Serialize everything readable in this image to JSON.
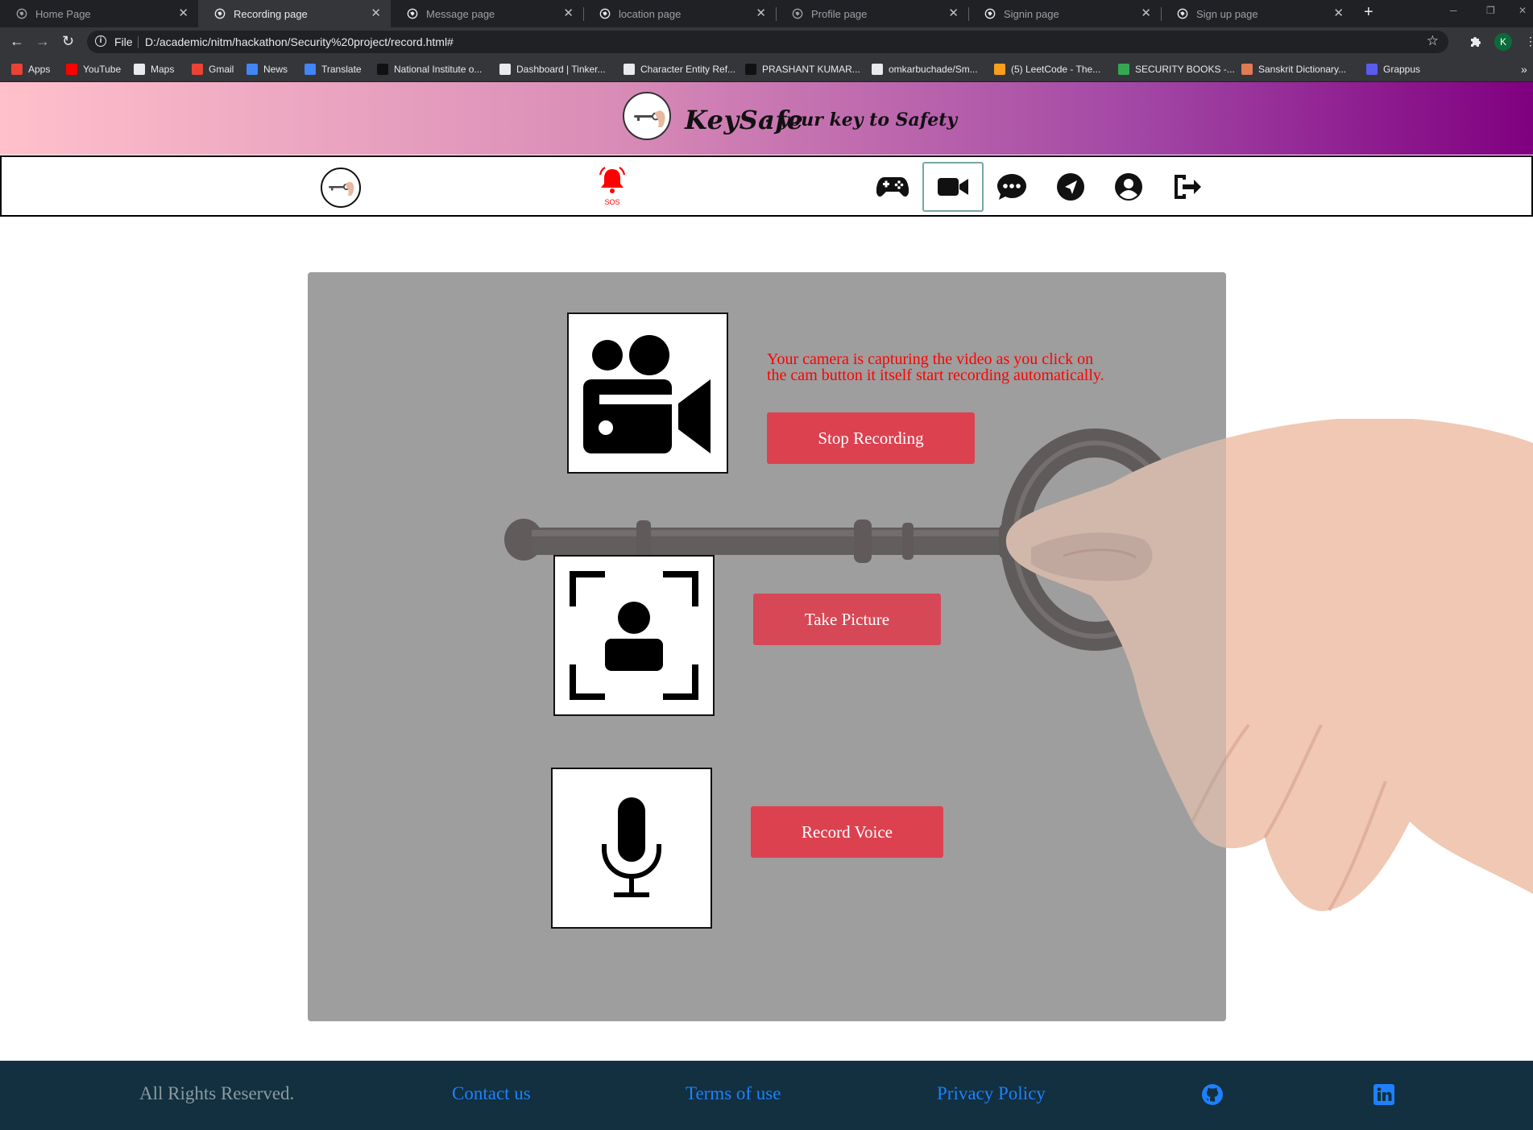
{
  "browser": {
    "tabs": [
      {
        "label": "Home Page",
        "active": false
      },
      {
        "label": "Recording page",
        "active": true
      },
      {
        "label": "Message page",
        "active": false
      },
      {
        "label": "location page",
        "active": false
      },
      {
        "label": "Profile page",
        "active": false
      },
      {
        "label": "Signin page",
        "active": false
      },
      {
        "label": "Sign up page",
        "active": false
      }
    ],
    "url_scheme_label": "File",
    "url": "D:/academic/nitm/hackathon/Security%20project/record.html#",
    "profile_initial": "K",
    "bookmarks": [
      {
        "label": "Apps",
        "icon": "apps-grid-icon",
        "color": "#ea4335"
      },
      {
        "label": "YouTube",
        "icon": "youtube-icon",
        "color": "#ff0000"
      },
      {
        "label": "Maps",
        "icon": "globe-icon",
        "color": "#e8eaed"
      },
      {
        "label": "Gmail",
        "icon": "gmail-icon",
        "color": "#ea4335"
      },
      {
        "label": "News",
        "icon": "news-icon",
        "color": "#4285f4"
      },
      {
        "label": "Translate",
        "icon": "translate-icon",
        "color": "#4285f4"
      },
      {
        "label": "National Institute o...",
        "icon": "nit-icon",
        "color": "#111111"
      },
      {
        "label": "Dashboard | Tinker...",
        "icon": "globe-icon",
        "color": "#e8eaed"
      },
      {
        "label": "Character Entity Ref...",
        "icon": "globe-icon",
        "color": "#e8eaed"
      },
      {
        "label": "PRASHANT KUMAR...",
        "icon": "medium-icon",
        "color": "#111111"
      },
      {
        "label": "omkarbuchade/Sm...",
        "icon": "globe-icon",
        "color": "#e8eaed"
      },
      {
        "label": "(5) LeetCode - The...",
        "icon": "leetcode-icon",
        "color": "#f89f1b"
      },
      {
        "label": "SECURITY BOOKS -...",
        "icon": "drive-icon",
        "color": "#34a853"
      },
      {
        "label": "Sanskrit Dictionary...",
        "icon": "dictionary-icon",
        "color": "#e07b53"
      },
      {
        "label": "Grappus",
        "icon": "grappus-icon",
        "color": "#5b5bf0"
      }
    ]
  },
  "site": {
    "brand": "KeySafe",
    "tagline": "- your key to Safety",
    "sos_label": "SOS",
    "nav_icons": [
      "gamepad-icon",
      "video-camera-icon",
      "chat-dots-icon",
      "location-arrow-icon",
      "user-circle-icon",
      "logout-icon"
    ],
    "active_nav": "video-camera-icon",
    "accent_color": "#dc4150",
    "header_gradient": [
      "#ffc0cb",
      "#800080"
    ]
  },
  "recording": {
    "camera_message": "Your camera is capturing the video as you click on the cam button it itself start recording automatically.",
    "stop_recording_label": "Stop Recording",
    "take_picture_label": "Take Picture",
    "record_voice_label": "Record Voice"
  },
  "footer": {
    "rights": "All Rights Reserved.",
    "contact": "Contact us",
    "terms": "Terms of use",
    "privacy": "Privacy Policy",
    "icons": [
      "github-icon",
      "linkedin-icon"
    ]
  }
}
